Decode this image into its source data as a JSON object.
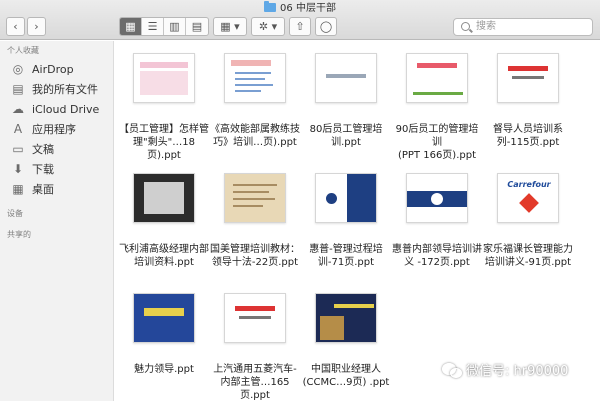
{
  "window": {
    "title": "06 中层干部"
  },
  "toolbar": {
    "back": "‹",
    "forward": "›",
    "views": [
      "▦",
      "☰",
      "▥",
      "▤"
    ],
    "arrange": "▦ ▾",
    "action": "✲ ▾",
    "share": "⇧",
    "tag": "◯"
  },
  "search": {
    "placeholder": "搜索"
  },
  "sidebar": {
    "favorites_title": "个人收藏",
    "favorites": [
      {
        "label": "AirDrop",
        "icon": "airdrop-icon"
      },
      {
        "label": "我的所有文件",
        "icon": "all-files-icon"
      },
      {
        "label": "iCloud Drive",
        "icon": "cloud-icon"
      },
      {
        "label": "应用程序",
        "icon": "applications-icon"
      },
      {
        "label": "文稿",
        "icon": "documents-icon"
      },
      {
        "label": "下载",
        "icon": "downloads-icon"
      },
      {
        "label": "桌面",
        "icon": "desktop-icon"
      }
    ],
    "devices_title": "设备",
    "shared_title": "共享的"
  },
  "files": [
    {
      "line1": "【员工管理】怎样管",
      "line2": "理\"剩头\"…18页).ppt"
    },
    {
      "line1": "《高效能部属教练技",
      "line2": "巧》培训…页).ppt"
    },
    {
      "line1": "80后员工管理培",
      "line2": "训.ppt"
    },
    {
      "line1": "90后员工的管理培训",
      "line2": "(PPT 166页).ppt"
    },
    {
      "line1": "督导人员培训系",
      "line2": "列-115页.ppt"
    },
    {
      "line1": "飞利浦高级经理内部",
      "line2": "培训资料.ppt"
    },
    {
      "line1": "国美管理培训教材：",
      "line2": "领导十法-22页.ppt"
    },
    {
      "line1": "惠普-管理过程培",
      "line2": "训-71页.ppt"
    },
    {
      "line1": "惠普内部领导培训讲",
      "line2": "义 -172页.ppt"
    },
    {
      "line1": "家乐福课长管理能力",
      "line2": "培训讲义-91页.ppt"
    },
    {
      "line1": "魅力领导.ppt",
      "line2": ""
    },
    {
      "line1": "上汽通用五菱汽车-",
      "line2": "内部主管…165页.ppt"
    },
    {
      "line1": "中国职业经理人",
      "line2": "(CCMC…9页) .ppt"
    }
  ],
  "thumbs": {
    "carrefour": "Carrefour"
  },
  "watermark": {
    "text": "微信号: hr90000"
  }
}
